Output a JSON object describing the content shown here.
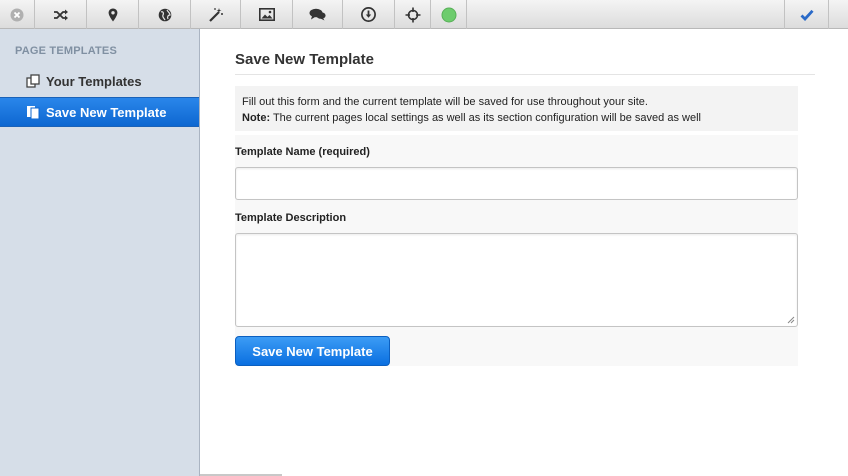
{
  "toolbar": {
    "icons": [
      "close-icon",
      "shuffle-icon",
      "map-pin-icon",
      "globe-icon",
      "magic-wand-icon",
      "image-icon",
      "comments-icon",
      "download-icon",
      "move-icon",
      "status-dot-icon",
      "checkmark-icon"
    ],
    "status_color": "#6dcc6d",
    "accent": "#2a6ac8"
  },
  "sidebar": {
    "heading": "PAGE TEMPLATES",
    "items": [
      {
        "label": "Your Templates",
        "active": false
      },
      {
        "label": "Save New Template",
        "active": true
      }
    ]
  },
  "main": {
    "title": "Save New Template",
    "info_line1": "Fill out this form and the current template will be saved for use throughout your site.",
    "info_note_label": "Note:",
    "info_note_text": " The current pages local settings as well as its section configuration will be saved as well",
    "name_label": "Template Name (required)",
    "name_value": "",
    "description_label": "Template Description",
    "description_value": "",
    "save_button": "Save New Template"
  }
}
